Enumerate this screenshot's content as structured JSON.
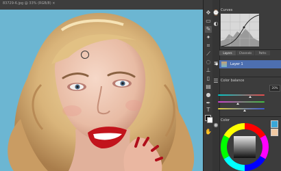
{
  "document": {
    "tab_label": "83729-6.jpg @ 33% (RGB/8) ×"
  },
  "panels": {
    "curves": {
      "title": "Curves"
    },
    "layers": {
      "tabs": [
        "Layers",
        "Channels",
        "Paths"
      ],
      "layer_name": "Layer 1"
    },
    "color_balance": {
      "title": "Color balance",
      "amount_value": "20%"
    },
    "color": {
      "title": "Color"
    }
  },
  "toolbar": {
    "icons": [
      "move-icon",
      "marquee-icon",
      "lasso-icon",
      "wand-icon",
      "crop-icon",
      "eyedropper-icon",
      "brush-icon",
      "stamp-icon",
      "eraser-icon",
      "gradient-icon",
      "dodge-icon",
      "pen-icon",
      "text-icon",
      "hand-icon"
    ]
  },
  "colors": {
    "canvas_background": "#6fb4cf",
    "panel_background": "#3c3c3c",
    "active_layer": "#4d6fb0",
    "foreground_swatch": "#111111",
    "background_swatch": "#ffffff"
  }
}
